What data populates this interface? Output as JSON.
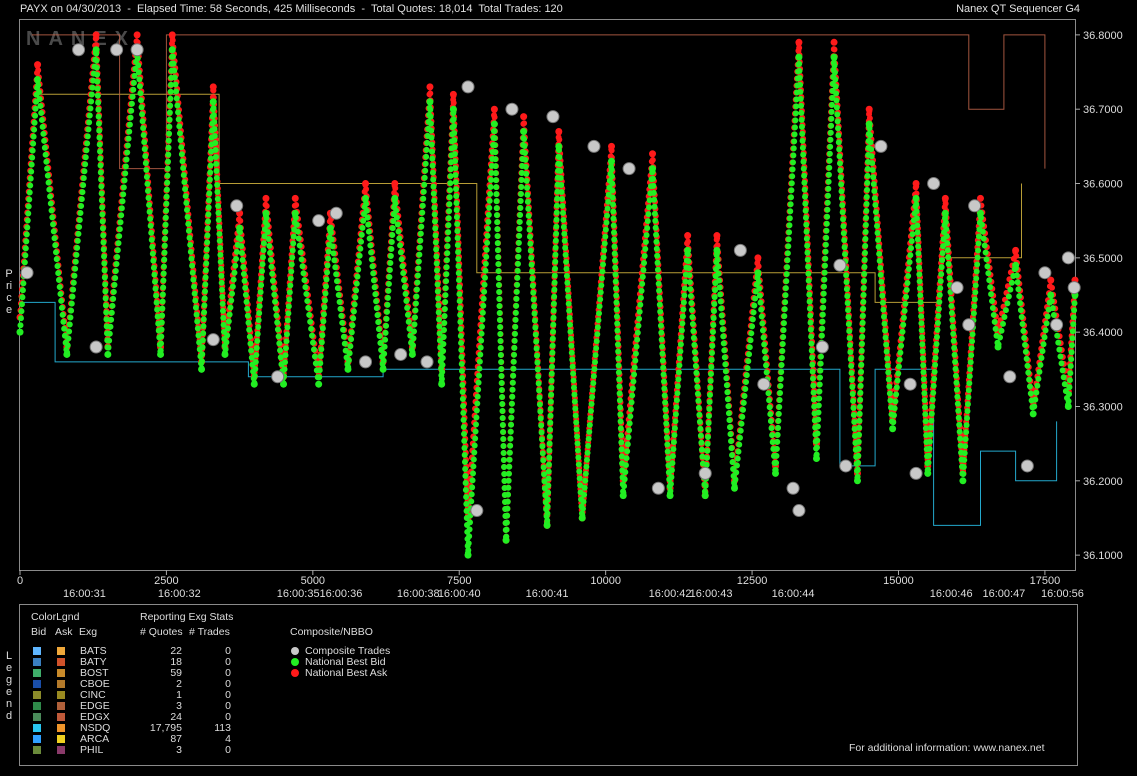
{
  "header": {
    "title": "PAYX on 04/30/2013  -  Elapsed Time: 58 Seconds, 425 Milliseconds  -  Total Quotes: 18,014  Total Trades: 120",
    "app": "Nanex QT Sequencer G4",
    "watermark": "NANEX"
  },
  "axis": {
    "price_label": "Price",
    "legend_label": "Legend"
  },
  "chart_data": {
    "type": "line",
    "y_ticks": [
      "36.8000",
      "36.7000",
      "36.6000",
      "36.5000",
      "36.4000",
      "36.3000",
      "36.2000",
      "36.1000"
    ],
    "ylim": [
      36.08,
      36.82
    ],
    "x_count_ticks": [
      "0",
      "2500",
      "5000",
      "7500",
      "10000",
      "12500",
      "15000",
      "17500"
    ],
    "xlim": [
      0,
      18014
    ],
    "time_ticks": [
      {
        "pos": 1100,
        "label": "16:00:31"
      },
      {
        "pos": 2720,
        "label": "16:00:32"
      },
      {
        "pos": 4750,
        "label": "16:00:35"
      },
      {
        "pos": 5480,
        "label": "16:00:36"
      },
      {
        "pos": 6800,
        "label": "16:00:38"
      },
      {
        "pos": 7500,
        "label": "16:00:40"
      },
      {
        "pos": 9000,
        "label": "16:00:41"
      },
      {
        "pos": 11100,
        "label": "16:00:42"
      },
      {
        "pos": 11800,
        "label": "16:00:43"
      },
      {
        "pos": 13200,
        "label": "16:00:44"
      },
      {
        "pos": 15900,
        "label": "16:00:46"
      },
      {
        "pos": 16800,
        "label": "16:00:47"
      },
      {
        "pos": 17800,
        "label": "16:00:56"
      }
    ],
    "series": [
      {
        "name": "National Best Ask",
        "color": "#ff1a1a",
        "x": [
          0,
          300,
          800,
          1300,
          1500,
          2000,
          2400,
          2600,
          3100,
          3300,
          3500,
          3750,
          4000,
          4200,
          4500,
          4700,
          5100,
          5300,
          5600,
          5900,
          6200,
          6400,
          6700,
          7000,
          7200,
          7400,
          7650,
          8100,
          8300,
          8600,
          9000,
          9200,
          9600,
          10100,
          10300,
          10800,
          11100,
          11400,
          11700,
          11900,
          12200,
          12600,
          12900,
          13300,
          13600,
          13900,
          14300,
          14500,
          14900,
          15300,
          15500,
          15800,
          16100,
          16400,
          16700,
          17000,
          17300,
          17600,
          17900,
          18014
        ],
        "y": [
          36.42,
          36.76,
          36.38,
          36.8,
          36.38,
          36.8,
          36.38,
          36.8,
          36.36,
          36.73,
          36.38,
          36.56,
          36.34,
          36.58,
          36.34,
          36.58,
          36.34,
          36.56,
          36.36,
          36.6,
          36.36,
          36.6,
          36.38,
          36.73,
          36.35,
          36.72,
          36.15,
          36.7,
          36.12,
          36.69,
          36.14,
          36.67,
          36.15,
          36.65,
          36.2,
          36.64,
          36.19,
          36.53,
          36.18,
          36.53,
          36.2,
          36.5,
          36.22,
          36.79,
          36.25,
          36.79,
          36.21,
          36.7,
          36.28,
          36.6,
          36.22,
          36.58,
          36.21,
          36.58,
          36.4,
          36.51,
          36.3,
          36.47,
          36.32,
          36.47
        ]
      },
      {
        "name": "National Best Bid",
        "color": "#22ee22",
        "x": [
          0,
          300,
          800,
          1300,
          1500,
          2000,
          2400,
          2600,
          3100,
          3300,
          3500,
          3750,
          4000,
          4200,
          4500,
          4700,
          5100,
          5300,
          5600,
          5900,
          6200,
          6400,
          6700,
          7000,
          7200,
          7400,
          7650,
          8100,
          8300,
          8600,
          9000,
          9200,
          9600,
          10100,
          10300,
          10800,
          11100,
          11400,
          11700,
          11900,
          12200,
          12600,
          12900,
          13300,
          13600,
          13900,
          14300,
          14500,
          14900,
          15300,
          15500,
          15800,
          16100,
          16400,
          16700,
          17000,
          17300,
          17600,
          17900,
          18014
        ],
        "y": [
          36.4,
          36.74,
          36.37,
          36.78,
          36.37,
          36.78,
          36.37,
          36.78,
          36.35,
          36.71,
          36.37,
          36.54,
          36.33,
          36.56,
          36.33,
          36.56,
          36.33,
          36.54,
          36.35,
          36.58,
          36.35,
          36.58,
          36.37,
          36.71,
          36.33,
          36.7,
          36.1,
          36.68,
          36.12,
          36.67,
          36.14,
          36.65,
          36.15,
          36.63,
          36.18,
          36.62,
          36.18,
          36.51,
          36.18,
          36.51,
          36.19,
          36.48,
          36.21,
          36.77,
          36.23,
          36.77,
          36.2,
          36.68,
          36.27,
          36.58,
          36.21,
          36.56,
          36.2,
          36.56,
          36.38,
          36.49,
          36.29,
          36.45,
          36.3,
          36.45
        ]
      },
      {
        "name": "Composite Trades",
        "color": "#c8c8c8",
        "x": [
          120,
          1000,
          1300,
          1650,
          2000,
          3300,
          3700,
          4400,
          5100,
          5400,
          5900,
          6500,
          6950,
          7650,
          7800,
          8400,
          9100,
          9800,
          10400,
          10900,
          11700,
          12300,
          12700,
          13200,
          13300,
          13700,
          14000,
          14100,
          14700,
          15200,
          15300,
          15600,
          16000,
          16200,
          16300,
          16900,
          17200,
          17500,
          17700,
          17900,
          18000
        ],
        "y": [
          36.48,
          36.78,
          36.38,
          36.78,
          36.78,
          36.39,
          36.57,
          36.34,
          36.55,
          36.56,
          36.36,
          36.37,
          36.36,
          36.73,
          36.16,
          36.7,
          36.69,
          36.65,
          36.62,
          36.19,
          36.21,
          36.51,
          36.33,
          36.19,
          36.16,
          36.38,
          36.49,
          36.22,
          36.65,
          36.33,
          36.21,
          36.6,
          36.46,
          36.41,
          36.57,
          36.34,
          36.22,
          36.48,
          36.41,
          36.5,
          36.46
        ]
      }
    ]
  },
  "legend": {
    "color_legend_title": "ColorLgnd",
    "bid_col": "Bid",
    "ask_col": "Ask",
    "exg_col": "Exg",
    "stats_title": "Reporting Exg Stats",
    "quotes_col": "# Quotes",
    "trades_col": "# Trades",
    "composite_title": "Composite/NBBO",
    "exchanges": [
      {
        "name": "BATS",
        "quotes": "22",
        "trades": "0",
        "bid_color": "#5fb6ff",
        "ask_color": "#f0a83a"
      },
      {
        "name": "BATY",
        "quotes": "18",
        "trades": "0",
        "bid_color": "#3a7fc0",
        "ask_color": "#d0522a"
      },
      {
        "name": "BOST",
        "quotes": "59",
        "trades": "0",
        "bid_color": "#3fae6a",
        "ask_color": "#c98a2a"
      },
      {
        "name": "CBOE",
        "quotes": "2",
        "trades": "0",
        "bid_color": "#1a4ea8",
        "ask_color": "#b47a2a"
      },
      {
        "name": "CINC",
        "quotes": "1",
        "trades": "0",
        "bid_color": "#8b8b2a",
        "ask_color": "#9a8a20"
      },
      {
        "name": "EDGE",
        "quotes": "3",
        "trades": "0",
        "bid_color": "#2f8a4a",
        "ask_color": "#b0603a"
      },
      {
        "name": "EDGX",
        "quotes": "24",
        "trades": "0",
        "bid_color": "#4a8a5a",
        "ask_color": "#c05a3a"
      },
      {
        "name": "NSDQ",
        "quotes": "17,795",
        "trades": "113",
        "bid_color": "#29c6f0",
        "ask_color": "#f0952a"
      },
      {
        "name": "ARCA",
        "quotes": "87",
        "trades": "4",
        "bid_color": "#2fa0ff",
        "ask_color": "#f0d020"
      },
      {
        "name": "PHIL",
        "quotes": "3",
        "trades": "0",
        "bid_color": "#6a8a3a",
        "ask_color": "#8a3a6a"
      }
    ],
    "composite_items": [
      {
        "label": "Composite Trades",
        "color": "#c8c8c8"
      },
      {
        "label": "National Best Bid",
        "color": "#22ee22"
      },
      {
        "label": "National Best Ask",
        "color": "#ff1a1a"
      }
    ],
    "footer": "For additional information: www.nanex.net"
  }
}
